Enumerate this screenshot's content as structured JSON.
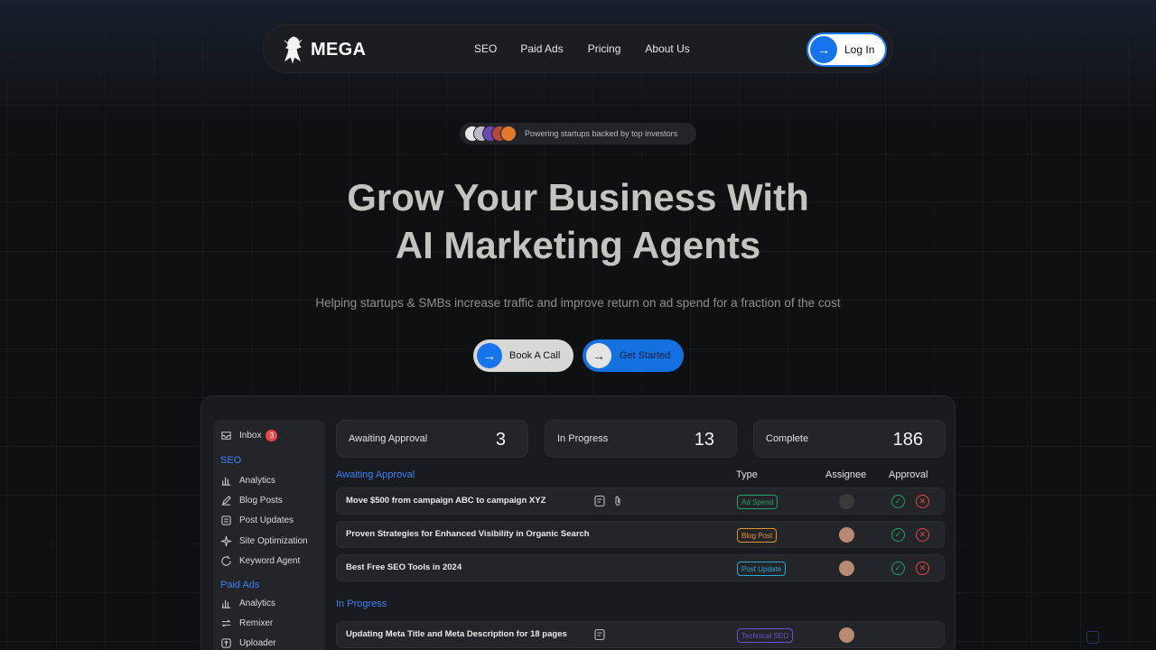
{
  "colors": {
    "accent": "#1774ea",
    "background": "#0f1012",
    "panel": "#242528",
    "section_blue": "#3b82f6",
    "approve": "#22a06b",
    "reject": "#e5484d"
  },
  "nav": {
    "brand": "MEGA",
    "logo_icon": "spartan-warrior-icon",
    "links": [
      "SEO",
      "Paid Ads",
      "Pricing",
      "About Us"
    ],
    "login_label": "Log In"
  },
  "badge": {
    "text": "Powering startups backed by top investors"
  },
  "hero": {
    "title_line1": "Grow Your Business With",
    "title_line2": "AI Marketing Agents",
    "subtitle": "Helping startups & SMBs increase traffic and improve return on ad spend for a fraction of the cost",
    "cta_primary": "Book A Call",
    "cta_secondary": "Get Started"
  },
  "dashboard": {
    "sidebar": {
      "inbox_label": "Inbox",
      "inbox_count": "3",
      "seo_heading": "SEO",
      "seo_items": [
        "Analytics",
        "Blog Posts",
        "Post Updates",
        "Site Optimization",
        "Keyword Agent"
      ],
      "paid_heading": "Paid Ads",
      "paid_items": [
        "Analytics",
        "Remixer",
        "Uploader"
      ]
    },
    "stats": [
      {
        "label": "Awaiting Approval",
        "value": "3"
      },
      {
        "label": "In Progress",
        "value": "13"
      },
      {
        "label": "Complete",
        "value": "186"
      }
    ],
    "columns": {
      "type": "Type",
      "assignee": "Assignee",
      "approval": "Approval"
    },
    "awaiting_heading": "Awaiting Approval",
    "in_progress_heading": "In Progress",
    "awaiting_rows": [
      {
        "title": "Move $500  from campaign ABC to campaign XYZ",
        "tag": "Ad Spend",
        "tag_color": "#22a06b"
      },
      {
        "title": "Proven Strategies for Enhanced Visibility in Organic Search",
        "tag": "Blog Post",
        "tag_color": "#e0962a"
      },
      {
        "title": "Best Free SEO Tools in 2024",
        "tag": "Post Update",
        "tag_color": "#2aa7d8"
      }
    ],
    "progress_rows": [
      {
        "title": "Updating Meta Title and Meta Description for 18 pages",
        "tag": "Technical SEO",
        "tag_color": "#6d4fd8"
      }
    ]
  }
}
